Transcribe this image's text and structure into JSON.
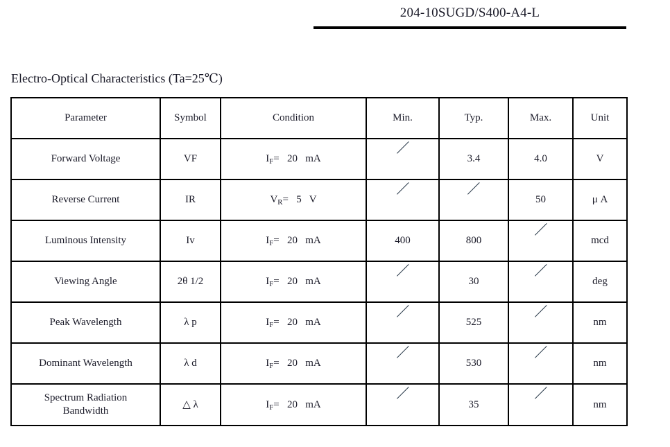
{
  "header": {
    "doc_code": "204-10SUGD/S400-A4-L"
  },
  "section": {
    "title": "Electro-Optical Characteristics (Ta=25℃)"
  },
  "table": {
    "columns": [
      "Parameter",
      "Symbol",
      "Condition",
      "Min.",
      "Typ.",
      "Max.",
      "Unit"
    ],
    "empty_mark": "/",
    "rows": [
      {
        "parameter": "Forward  Voltage",
        "symbol": "VF",
        "condition_prefix": "I",
        "condition_sub": "F",
        "condition_rest": "=   20   mA",
        "min": "/",
        "typ": "3.4",
        "max": "4.0",
        "unit": "V"
      },
      {
        "parameter": "Reverse  Current",
        "symbol": "IR",
        "condition_prefix": "V",
        "condition_sub": "R",
        "condition_rest": "=   5   V",
        "min": "/",
        "typ": "/",
        "max": "50",
        "unit": "μ A"
      },
      {
        "parameter": "Luminous Intensity",
        "symbol": "Iv",
        "condition_prefix": "I",
        "condition_sub": "F",
        "condition_rest": "=   20   mA",
        "min": "400",
        "typ": "800",
        "max": "/",
        "unit": "mcd"
      },
      {
        "parameter": "Viewing Angle",
        "symbol": "2θ 1/2",
        "condition_prefix": "I",
        "condition_sub": "F",
        "condition_rest": "=   20   mA",
        "min": "/",
        "typ": "30",
        "max": "/",
        "unit": "deg"
      },
      {
        "parameter": "Peak Wavelength",
        "symbol": "λ p",
        "condition_prefix": "I",
        "condition_sub": "F",
        "condition_rest": "=   20   mA",
        "min": "/",
        "typ": "525",
        "max": "/",
        "unit": "nm"
      },
      {
        "parameter": "Dominant Wavelength",
        "symbol": "λ d",
        "condition_prefix": "I",
        "condition_sub": "F",
        "condition_rest": "=   20   mA",
        "min": "/",
        "typ": "530",
        "max": "/",
        "unit": "nm"
      },
      {
        "parameter": "Spectrum Radiation\nBandwidth",
        "symbol": "△ λ",
        "condition_prefix": "I",
        "condition_sub": "F",
        "condition_rest": "=   20   mA",
        "min": "/",
        "typ": "35",
        "max": "/",
        "unit": "nm"
      }
    ]
  }
}
